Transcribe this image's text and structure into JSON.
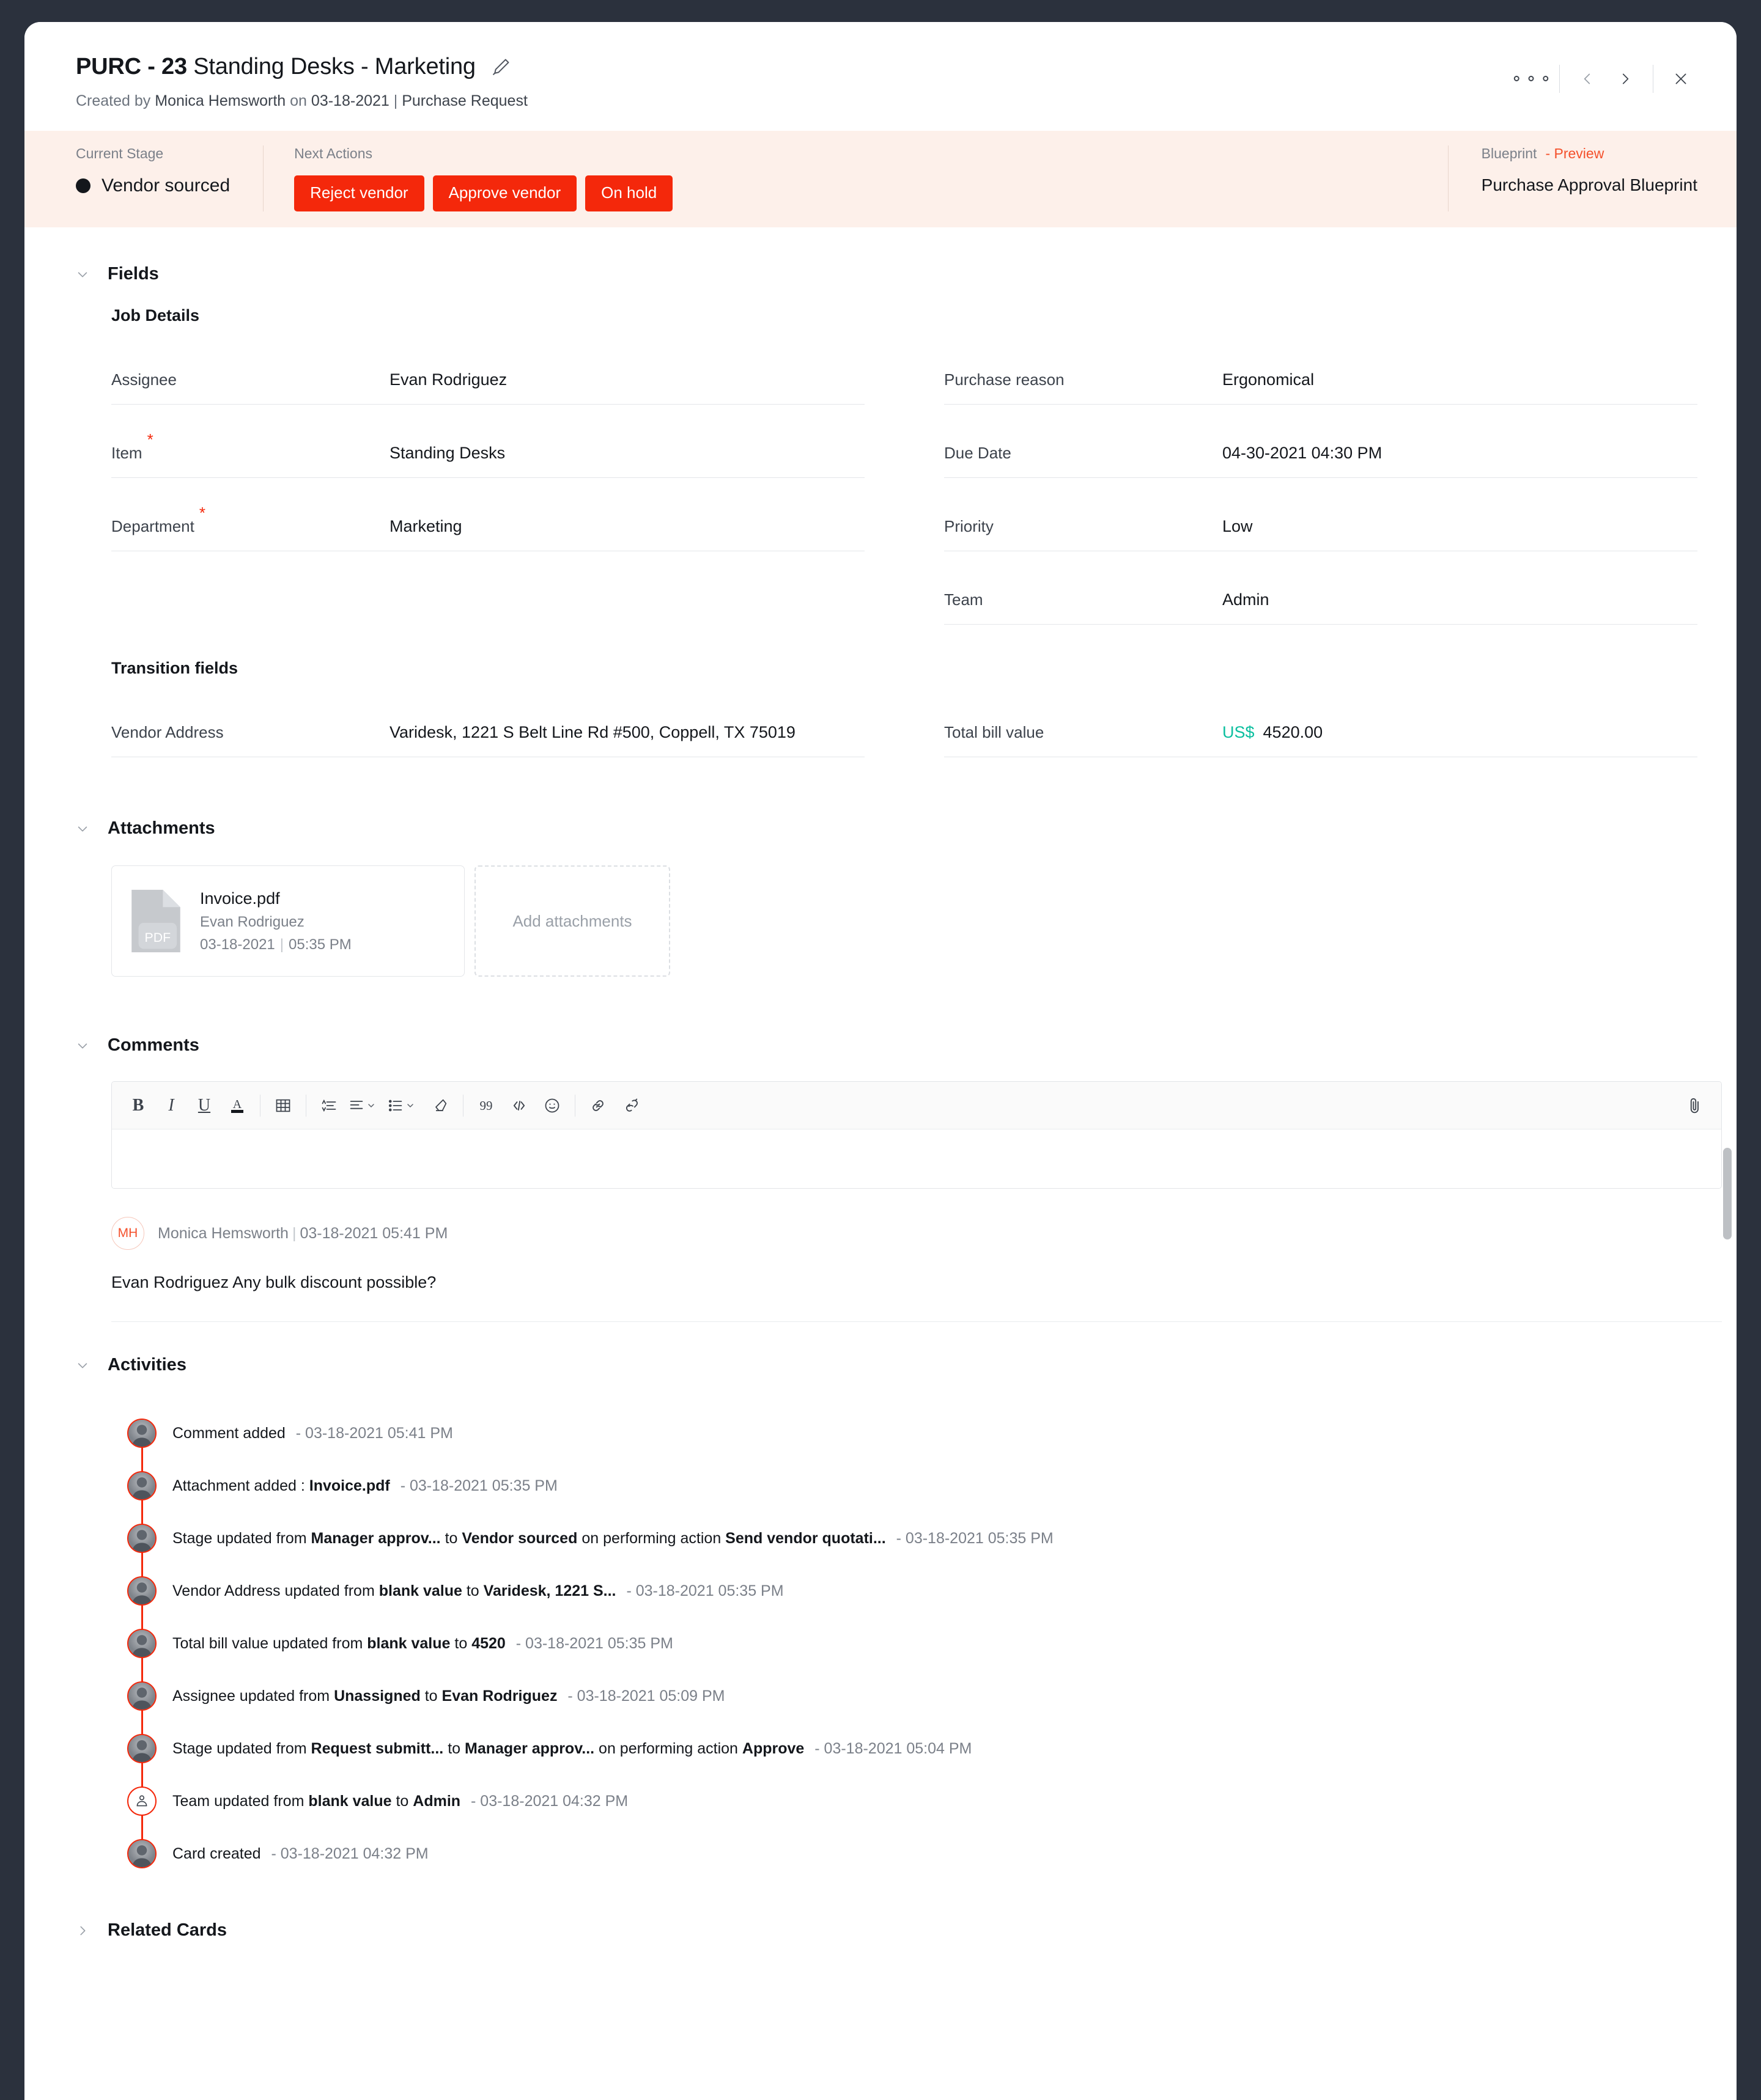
{
  "header": {
    "code": "PURC - 23",
    "name": "Standing Desks - Marketing",
    "edit_icon": "pencil-icon",
    "created_prefix": "Created by",
    "creator": "Monica Hemsworth",
    "created_on_prefix": "on",
    "created_date": "03-18-2021",
    "separator": "|",
    "record_type": "Purchase Request",
    "more_icon": "more-options-icon",
    "prev_icon": "chevron-left-icon",
    "next_icon": "chevron-right-icon",
    "close_icon": "close-icon"
  },
  "banner": {
    "current_stage_label": "Current Stage",
    "current_stage_value": "Vendor sourced",
    "next_actions_label": "Next Actions",
    "actions": [
      "Reject vendor",
      "Approve vendor",
      "On hold"
    ],
    "blueprint_label": "Blueprint",
    "blueprint_preview": "- Preview",
    "blueprint_name": "Purchase Approval Blueprint",
    "accent_color": "#f4280b",
    "background_color": "#fdf0ea"
  },
  "fields_section": {
    "title": "Fields",
    "group_title": "Job Details",
    "left": [
      {
        "label": "Assignee",
        "value": "Evan Rodriguez",
        "required": false
      },
      {
        "label": "Item",
        "value": "Standing Desks",
        "required": true
      },
      {
        "label": "Department",
        "value": "Marketing",
        "required": true
      }
    ],
    "right": [
      {
        "label": "Purchase reason",
        "value": "Ergonomical",
        "required": false
      },
      {
        "label": "Due Date",
        "value": "04-30-2021 04:30 PM",
        "required": false
      },
      {
        "label": "Priority",
        "value": "Low",
        "required": false
      },
      {
        "label": "Team",
        "value": "Admin",
        "required": false
      }
    ],
    "transition_title": "Transition fields",
    "transition_left": [
      {
        "label": "Vendor Address",
        "value": "Varidesk, 1221 S Belt Line Rd #500, Coppell, TX 75019"
      }
    ],
    "transition_right": [
      {
        "label": "Total bill value",
        "currency": "US$",
        "value": "4520.00",
        "currency_color": "#0bbf9f"
      }
    ]
  },
  "attachments_section": {
    "title": "Attachments",
    "file": {
      "icon": "pdf-file-icon",
      "badge": "PDF",
      "name": "Invoice.pdf",
      "uploader": "Evan Rodriguez",
      "date": "03-18-2021",
      "time": "05:35 PM"
    },
    "add_label": "Add attachments"
  },
  "comments_section": {
    "title": "Comments",
    "toolbar": [
      {
        "name": "bold-icon",
        "glyph": "B"
      },
      {
        "name": "italic-icon",
        "glyph": "I"
      },
      {
        "name": "underline-icon",
        "glyph": "U"
      },
      {
        "name": "text-color-icon",
        "glyph": "A"
      },
      {
        "name": "table-icon",
        "glyph": "table"
      },
      {
        "name": "line-height-icon",
        "glyph": "lineheight"
      },
      {
        "name": "align-icon",
        "glyph": "align"
      },
      {
        "name": "bullet-list-icon",
        "glyph": "list"
      },
      {
        "name": "clear-format-icon",
        "glyph": "eraser"
      },
      {
        "name": "blockquote-icon",
        "glyph": "quote"
      },
      {
        "name": "code-icon",
        "glyph": "code"
      },
      {
        "name": "emoji-icon",
        "glyph": "emoji"
      },
      {
        "name": "link-icon",
        "glyph": "link"
      },
      {
        "name": "unlink-icon",
        "glyph": "unlink"
      },
      {
        "name": "attach-icon",
        "glyph": "paperclip"
      }
    ],
    "editor_value": "",
    "comment": {
      "avatar_initials": "MH",
      "author": "Monica Hemsworth",
      "separator": "|",
      "timestamp": "03-18-2021 05:41 PM",
      "text": "Evan Rodriguez Any bulk discount possible?"
    }
  },
  "activities_section": {
    "title": "Activities",
    "items": [
      {
        "avatar": "user-avatar",
        "parts": [
          {
            "t": "Comment added",
            "s": "n"
          },
          {
            "t": "- 03-18-2021 05:41 PM",
            "s": "time"
          }
        ]
      },
      {
        "avatar": "user-avatar",
        "parts": [
          {
            "t": "Attachment added :",
            "s": "n"
          },
          {
            "t": "Invoice.pdf",
            "s": "b"
          },
          {
            "t": "- 03-18-2021 05:35 PM",
            "s": "time"
          }
        ]
      },
      {
        "avatar": "user-avatar",
        "parts": [
          {
            "t": "Stage updated from",
            "s": "n"
          },
          {
            "t": "Manager approv...",
            "s": "b"
          },
          {
            "t": "to",
            "s": "n"
          },
          {
            "t": "Vendor sourced",
            "s": "b"
          },
          {
            "t": "on performing action",
            "s": "n"
          },
          {
            "t": "Send vendor quotati...",
            "s": "b"
          },
          {
            "t": "- 03-18-2021 05:35 PM",
            "s": "time"
          }
        ]
      },
      {
        "avatar": "user-avatar",
        "parts": [
          {
            "t": "Vendor Address updated from",
            "s": "n"
          },
          {
            "t": "blank value",
            "s": "b"
          },
          {
            "t": "to",
            "s": "n"
          },
          {
            "t": "Varidesk, 1221 S...",
            "s": "b"
          },
          {
            "t": "- 03-18-2021 05:35 PM",
            "s": "time"
          }
        ]
      },
      {
        "avatar": "user-avatar",
        "parts": [
          {
            "t": "Total bill value updated from",
            "s": "n"
          },
          {
            "t": "blank value",
            "s": "b"
          },
          {
            "t": "to",
            "s": "n"
          },
          {
            "t": "4520",
            "s": "b"
          },
          {
            "t": "- 03-18-2021 05:35 PM",
            "s": "time"
          }
        ]
      },
      {
        "avatar": "user-avatar",
        "parts": [
          {
            "t": "Assignee updated from",
            "s": "n"
          },
          {
            "t": "Unassigned",
            "s": "b"
          },
          {
            "t": "to",
            "s": "n"
          },
          {
            "t": "Evan Rodriguez",
            "s": "b"
          },
          {
            "t": "- 03-18-2021 05:09 PM",
            "s": "time"
          }
        ]
      },
      {
        "avatar": "user-avatar",
        "parts": [
          {
            "t": "Stage updated from",
            "s": "n"
          },
          {
            "t": "Request submitt...",
            "s": "b"
          },
          {
            "t": "to",
            "s": "n"
          },
          {
            "t": "Manager approv...",
            "s": "b"
          },
          {
            "t": "on performing action",
            "s": "n"
          },
          {
            "t": "Approve",
            "s": "b"
          },
          {
            "t": "- 03-18-2021 05:04 PM",
            "s": "time"
          }
        ]
      },
      {
        "avatar": "team-icon",
        "parts": [
          {
            "t": "Team updated from",
            "s": "n"
          },
          {
            "t": "blank value",
            "s": "b"
          },
          {
            "t": "to",
            "s": "n"
          },
          {
            "t": "Admin",
            "s": "b"
          },
          {
            "t": "- 03-18-2021 04:32 PM",
            "s": "time"
          }
        ]
      },
      {
        "avatar": "user-avatar",
        "parts": [
          {
            "t": "Card created",
            "s": "n"
          },
          {
            "t": "- 03-18-2021 04:32 PM",
            "s": "time"
          }
        ]
      }
    ]
  },
  "related_section": {
    "title": "Related Cards"
  }
}
